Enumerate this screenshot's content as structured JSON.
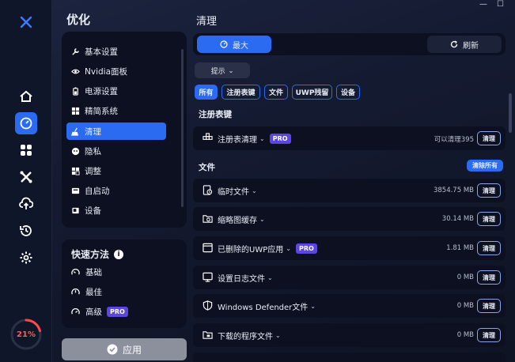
{
  "nav": {
    "items": [
      {
        "icon": "home-icon"
      },
      {
        "icon": "gauge-icon"
      },
      {
        "icon": "grid-icon"
      },
      {
        "icon": "tools-icon"
      },
      {
        "icon": "cloud-upload-icon"
      },
      {
        "icon": "history-icon"
      },
      {
        "icon": "gear-icon"
      }
    ],
    "score": "21%",
    "score_fraction": 0.21
  },
  "sidebar": {
    "title": "优化",
    "items": [
      {
        "label": "基本设置",
        "icon": "wrench-icon"
      },
      {
        "label": "Nvidia面板",
        "icon": "nvidia-icon"
      },
      {
        "label": "电源设置",
        "icon": "battery-icon"
      },
      {
        "label": "精简系统",
        "icon": "windows-icon"
      },
      {
        "label": "清理",
        "icon": "broom-icon"
      },
      {
        "label": "隐私",
        "icon": "privacy-icon"
      },
      {
        "label": "调整",
        "icon": "sliders-icon"
      },
      {
        "label": "自启动",
        "icon": "startup-icon"
      },
      {
        "label": "设备",
        "icon": "device-icon"
      }
    ]
  },
  "quick": {
    "title": "快速方法",
    "info": "i",
    "items": [
      {
        "label": "基础"
      },
      {
        "label": "最佳"
      },
      {
        "label": "高级",
        "badge": "PRO"
      }
    ],
    "apply": "应用"
  },
  "main": {
    "title": "清理",
    "mode_max": "最大",
    "mode_refresh": "刷新",
    "hint": "提示",
    "filters": [
      "所有",
      "注册表键",
      "文件",
      "UWP残留",
      "设备"
    ],
    "registry_title": "注册表键",
    "registry": {
      "label": "注册表清理",
      "badge": "PRO",
      "size": "可以清理395",
      "action": "清理"
    },
    "files_title": "文件",
    "clear_all": "清除所有",
    "files": [
      {
        "label": "临时文件",
        "size": "3854.75 MB",
        "action": "清理"
      },
      {
        "label": "缩略图缓存",
        "size": "30.14 MB",
        "action": "清理"
      },
      {
        "label": "已删除的UWP应用",
        "badge": "PRO",
        "size": "1.81 MB",
        "action": "清理"
      },
      {
        "label": "设置日志文件",
        "size": "0 MB",
        "action": "清理"
      },
      {
        "label": "Windows Defender文件",
        "size": "0 MB",
        "action": "清理"
      },
      {
        "label": "下载的程序文件",
        "size": "0 MB",
        "action": "清理"
      }
    ]
  }
}
